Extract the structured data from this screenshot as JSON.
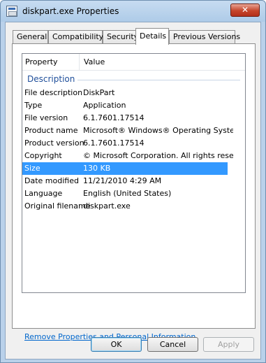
{
  "window": {
    "title": "diskpart.exe Properties",
    "close_glyph": "✕"
  },
  "tabs": [
    {
      "label": "General"
    },
    {
      "label": "Compatibility"
    },
    {
      "label": "Security"
    },
    {
      "label": "Details"
    },
    {
      "label": "Previous Versions"
    }
  ],
  "details": {
    "columns": {
      "property": "Property",
      "value": "Value"
    },
    "group": "Description",
    "rows": [
      {
        "property": "File description",
        "value": "DiskPart"
      },
      {
        "property": "Type",
        "value": "Application"
      },
      {
        "property": "File version",
        "value": "6.1.7601.17514"
      },
      {
        "property": "Product name",
        "value": "Microsoft® Windows® Operating System"
      },
      {
        "property": "Product version",
        "value": "6.1.7601.17514"
      },
      {
        "property": "Copyright",
        "value": "© Microsoft Corporation. All rights reserv..."
      },
      {
        "property": "Size",
        "value": "130 KB"
      },
      {
        "property": "Date modified",
        "value": "11/21/2010 4:29 AM"
      },
      {
        "property": "Language",
        "value": "English (United States)"
      },
      {
        "property": "Original filename",
        "value": "diskpart.exe"
      }
    ]
  },
  "link": "Remove Properties and Personal Information",
  "buttons": {
    "ok": "OK",
    "cancel": "Cancel",
    "apply": "Apply"
  },
  "colors": {
    "selection": "#3399ff",
    "link": "#0066cc",
    "group": "#1e4e9a"
  }
}
